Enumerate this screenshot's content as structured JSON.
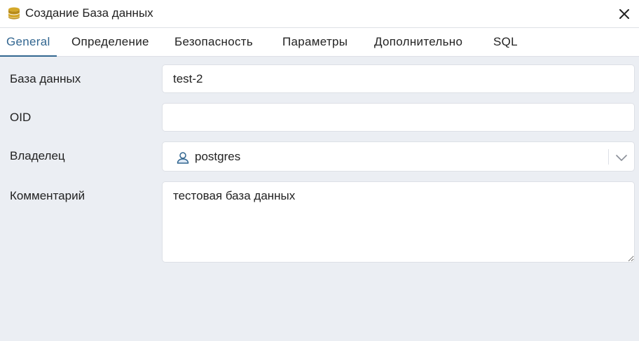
{
  "dialog": {
    "title": "Создание База данных",
    "icon": "database-icon",
    "close_icon": "close-icon"
  },
  "tabs": [
    {
      "label": "General",
      "active": true
    },
    {
      "label": "Определение",
      "active": false
    },
    {
      "label": "Безопасность",
      "active": false
    },
    {
      "label": "Параметры",
      "active": false
    },
    {
      "label": "Дополнительно",
      "active": false
    },
    {
      "label": "SQL",
      "active": false
    }
  ],
  "form": {
    "database": {
      "label": "База данных",
      "value": "test-2"
    },
    "oid": {
      "label": "OID",
      "value": ""
    },
    "owner": {
      "label": "Владелец",
      "value": "postgres",
      "icon": "user-icon"
    },
    "comment": {
      "label": "Комментарий",
      "value": "тестовая база данных"
    }
  },
  "colors": {
    "accent": "#326690",
    "background": "#ebeef3",
    "border": "#dde0e6",
    "db_icon": "#c9a227"
  }
}
